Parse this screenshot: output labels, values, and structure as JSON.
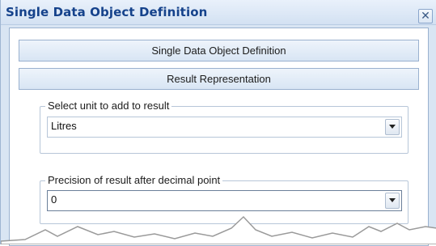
{
  "window": {
    "title": "Single Data Object Definition",
    "close_label": "✕"
  },
  "sections": [
    {
      "label": "Single Data Object Definition"
    },
    {
      "label": "Result Representation"
    }
  ],
  "unit_group": {
    "legend": "Select unit to add to result",
    "selected_value": "Litres"
  },
  "precision_group": {
    "legend": "Precision of result after decimal point",
    "selected_value": "0"
  },
  "icons": {
    "close": "close-icon",
    "dropdown": "chevron-down-icon"
  },
  "colors": {
    "title_text": "#15428b",
    "frame": "#d9e5f3",
    "border": "#9ab1cf"
  }
}
